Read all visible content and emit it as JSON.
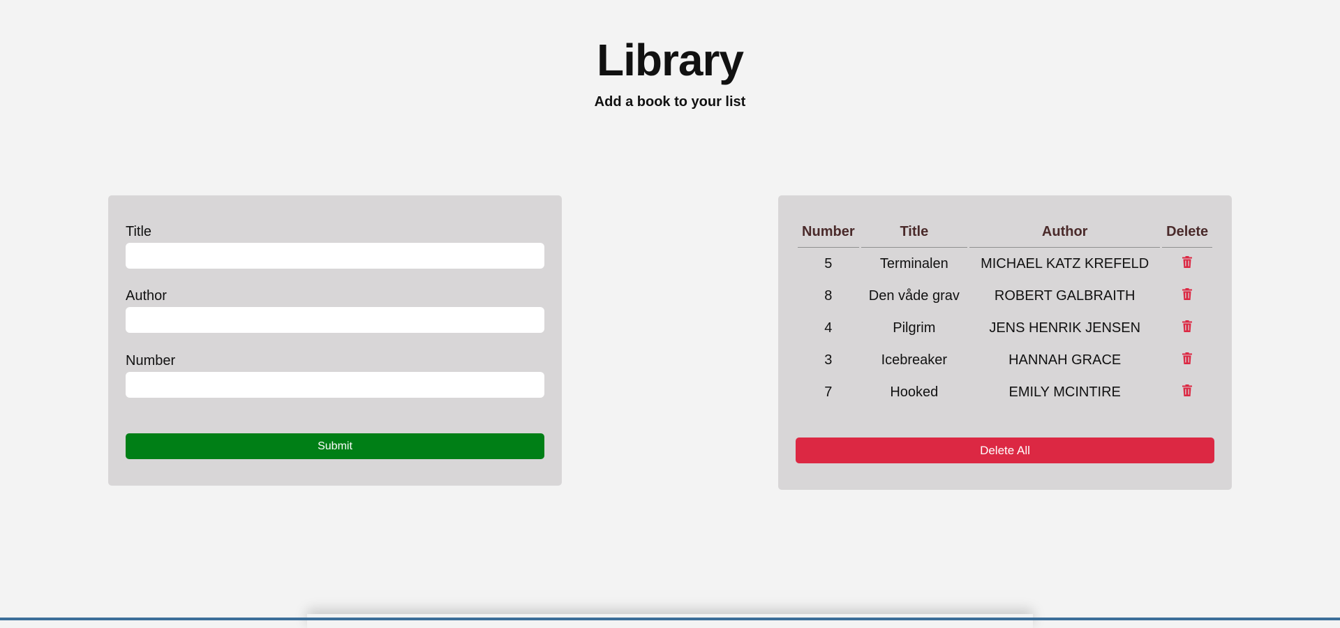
{
  "header": {
    "title": "Library",
    "subtitle": "Add a book to your list"
  },
  "form": {
    "title_label": "Title",
    "title_value": "",
    "author_label": "Author",
    "author_value": "",
    "number_label": "Number",
    "number_value": "",
    "submit_label": "Submit"
  },
  "table": {
    "headers": [
      "Number",
      "Title",
      "Author",
      "Delete"
    ],
    "rows": [
      {
        "number": "5",
        "title": "Terminalen",
        "author": "MICHAEL KATZ KREFELD"
      },
      {
        "number": "8",
        "title": "Den våde grav",
        "author": "ROBERT GALBRAITH"
      },
      {
        "number": "4",
        "title": "Pilgrim",
        "author": "JENS HENRIK JENSEN"
      },
      {
        "number": "3",
        "title": "Icebreaker",
        "author": "HANNAH GRACE"
      },
      {
        "number": "7",
        "title": "Hooked",
        "author": "EMILY MCINTIRE"
      }
    ],
    "delete_icon": "trash-icon",
    "delete_all_label": "Delete All"
  },
  "colors": {
    "background": "#f3f3f3",
    "card": "#d8d6d7",
    "submit": "#007f16",
    "delete": "#dc2843",
    "header_text": "#4a2a2a"
  }
}
